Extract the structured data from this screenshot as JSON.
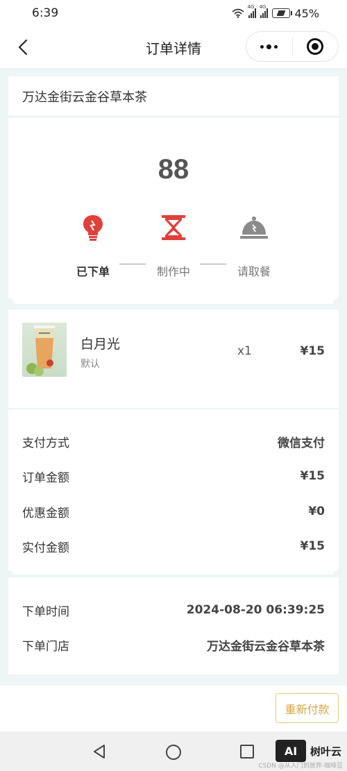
{
  "status_bar": {
    "time": "6:39",
    "signal_tag_1": "4G",
    "signal_tag_2": "4G",
    "battery": "45%"
  },
  "nav": {
    "title": "订单详情",
    "back_icon": "chevron-left-icon",
    "more_icon": "more-dots-icon",
    "close_icon": "target-close-icon"
  },
  "store": {
    "name": "万达金街云金谷草本茶"
  },
  "order_status": {
    "pickup_number": "88",
    "steps": [
      {
        "label": "已下单",
        "icon": "lightbulb-icon",
        "active": true
      },
      {
        "label": "制作中",
        "icon": "hourglass-icon",
        "active": false
      },
      {
        "label": "请取餐",
        "icon": "service-bell-icon",
        "active": false
      }
    ],
    "colors": {
      "active_icon": "#e0403a",
      "inactive_icon": "#8a8a8a"
    }
  },
  "product": {
    "name": "白月光",
    "spec": "默认",
    "qty": "x1",
    "price": "¥15"
  },
  "payment": {
    "rows": [
      {
        "label": "支付方式",
        "value": "微信支付"
      },
      {
        "label": "订单金额",
        "value": "¥15"
      },
      {
        "label": "优惠金额",
        "value": "¥0"
      },
      {
        "label": "实付金额",
        "value": "¥15"
      }
    ]
  },
  "order_info": {
    "rows": [
      {
        "label": "下单时间",
        "value": "2024-08-20 06:39:25"
      },
      {
        "label": "下单门店",
        "value": "万达金街云金谷草本茶"
      }
    ]
  },
  "actions": {
    "repay_label": "重新付款",
    "accent": "#d6a642"
  },
  "watermark": {
    "logo_text": "AI",
    "brand": "树叶云",
    "csdn": "CSDN @从入门到放弃-咖啡豆"
  }
}
